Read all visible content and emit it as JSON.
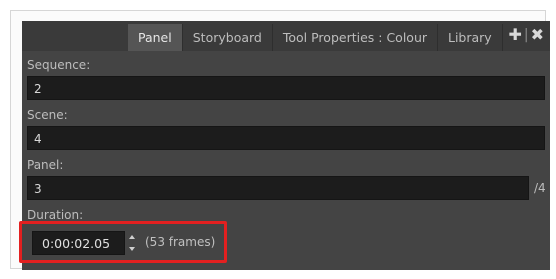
{
  "tabs": [
    {
      "label": "Panel",
      "active": true
    },
    {
      "label": "Storyboard",
      "active": false
    },
    {
      "label": "Tool Properties : Colour",
      "active": false
    },
    {
      "label": "Library",
      "active": false
    }
  ],
  "controls": {
    "add_icon": "plus-icon",
    "close_icon": "close-icon"
  },
  "fields": {
    "sequence": {
      "label": "Sequence:",
      "value": "2"
    },
    "scene": {
      "label": "Scene:",
      "value": "4"
    },
    "panel": {
      "label": "Panel:",
      "value": "3",
      "total": "/4"
    },
    "duration": {
      "label": "Duration:",
      "value": "0:00:02.05",
      "frames": "(53 frames)"
    }
  },
  "colors": {
    "panel_bg": "#444444",
    "field_bg": "#1c1c1c",
    "active_tab": "#555555",
    "highlight": "#e32020"
  }
}
